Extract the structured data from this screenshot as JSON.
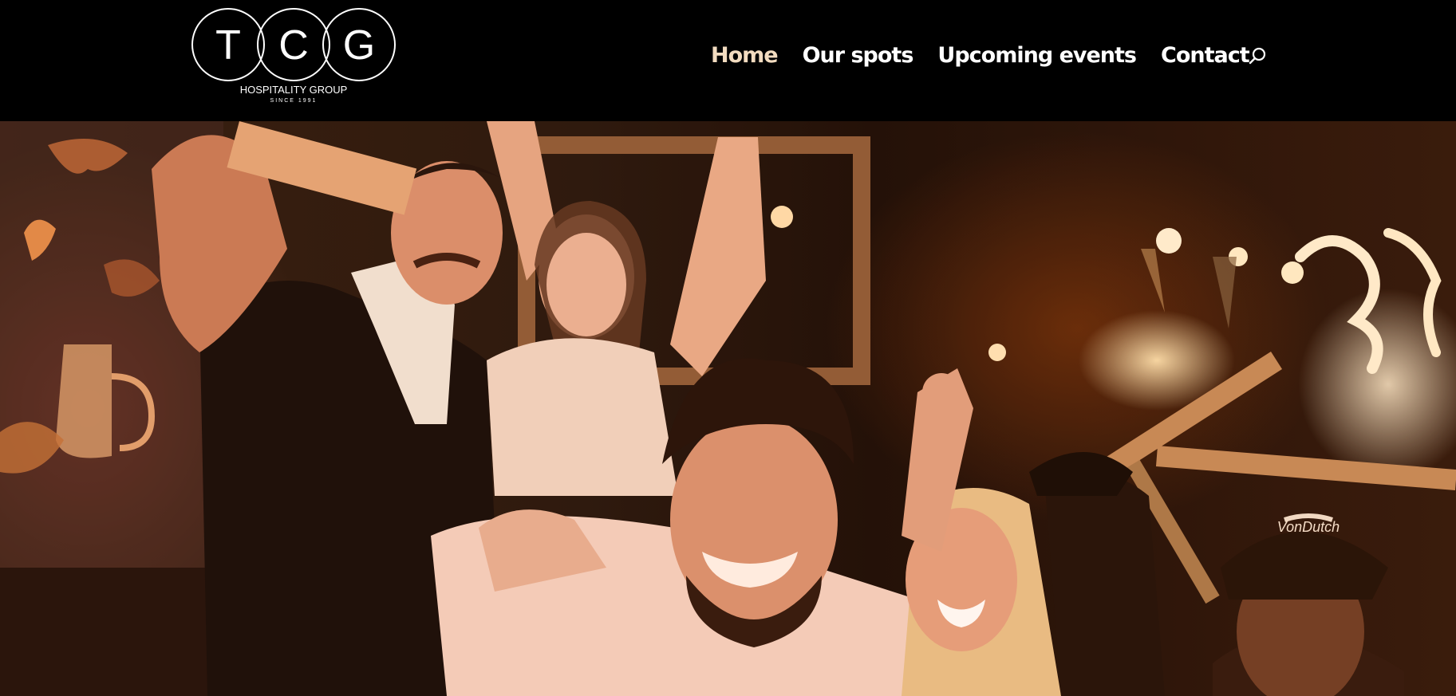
{
  "brand": {
    "letters": [
      "T",
      "C",
      "G"
    ],
    "name": "HOSPITALITY GROUP",
    "tagline": "SINCE 1991"
  },
  "nav": {
    "items": [
      {
        "label": "Home",
        "active": true
      },
      {
        "label": "Our spots",
        "active": false
      },
      {
        "label": "Upcoming events",
        "active": false
      },
      {
        "label": "Contact",
        "active": false
      }
    ],
    "search_icon": "search-icon"
  },
  "hero": {
    "image": "party crowd photo",
    "hat_text": "VonDutch"
  },
  "colors": {
    "header_bg": "#000000",
    "nav_text": "#ffffff",
    "nav_active": "#f3dcc0"
  }
}
